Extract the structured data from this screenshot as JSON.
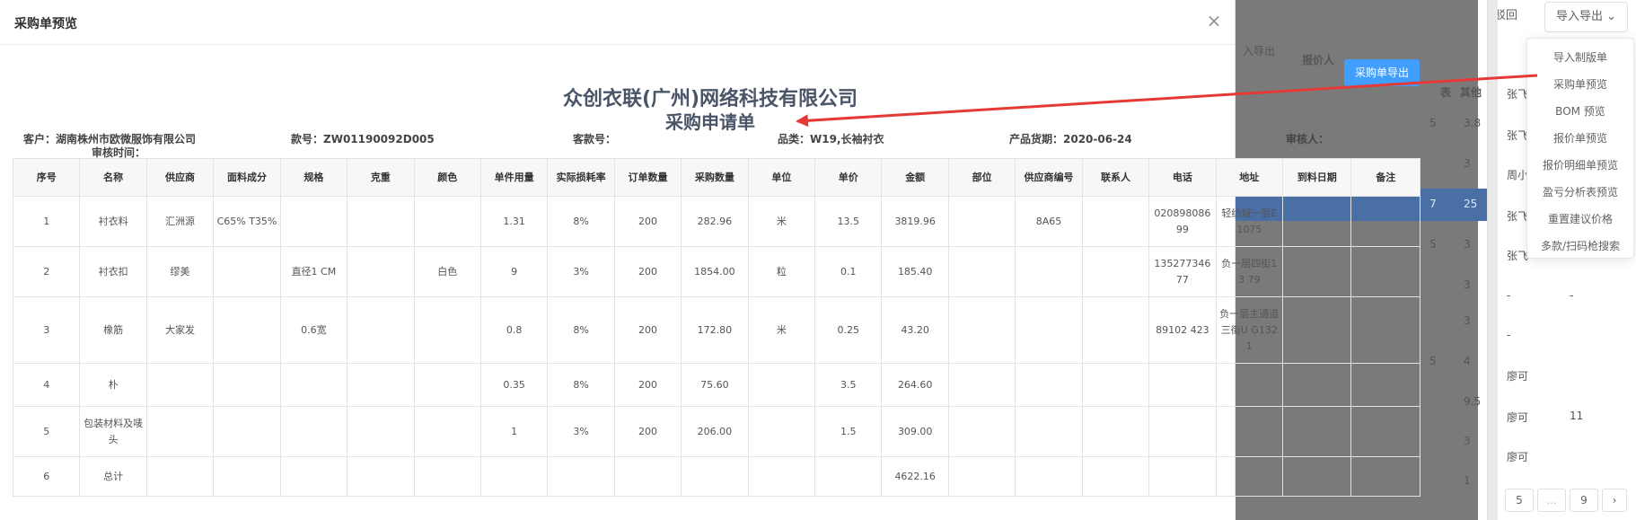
{
  "background": {
    "buttons": {
      "reject": "驳回",
      "import_export": "导入导出"
    },
    "faded_header": [
      "入导出",
      "报价人"
    ],
    "faded_cols": [
      "表",
      "其他"
    ],
    "col_values": [
      {
        "a": "5",
        "b": "3.8"
      },
      {
        "a": "",
        "b": "3"
      },
      {
        "a": "7",
        "b": "25"
      },
      {
        "a": "5",
        "b": "3"
      },
      {
        "a": "",
        "b": "3"
      },
      {
        "a": "",
        "b": "3"
      },
      {
        "a": "5",
        "b": "4"
      },
      {
        "a": "",
        "b": "9.5"
      },
      {
        "a": "",
        "b": "3"
      },
      {
        "a": "",
        "b": "1"
      }
    ],
    "names": [
      "张飞",
      "张飞",
      "周小",
      "张飞",
      "张飞",
      "-",
      "-",
      "廖可",
      "廖可",
      "廖可"
    ],
    "name_extra": [
      "",
      "",
      "",
      "",
      "",
      "-",
      "",
      "",
      "11",
      ""
    ],
    "pager": [
      "5",
      "...",
      "9",
      "›"
    ]
  },
  "dropdown": {
    "items": [
      "导入制版单",
      "采购单预览",
      "BOM 预览",
      "报价单预览",
      "报价明细单预览",
      "盈亏分析表预览",
      "重置建议价格",
      "多款/扫码枪搜索"
    ]
  },
  "modal": {
    "title": "采购单预览",
    "close": "×",
    "export_button": "采购单导出",
    "company": "众创衣联(广州)网络科技有限公司",
    "subtitle": "采购申请单",
    "info": {
      "customer": "客户：湖南株州市欧微服饰有限公司",
      "style_no": "款号：ZW01190092D005",
      "customer_style": "客款号：",
      "category": "品类：W19,长袖衬衣",
      "delivery": "产品货期：2020-06-24",
      "auditor": "审核人：",
      "audit_time": "审核时间："
    },
    "table": {
      "headers": [
        "序号",
        "名称",
        "供应商",
        "面料成分",
        "规格",
        "克重",
        "颜色",
        "单件用量",
        "实际损耗率",
        "订单数量",
        "采购数量",
        "单位",
        "单价",
        "金额",
        "部位",
        "供应商编号",
        "联系人",
        "电话",
        "地址",
        "到料日期",
        "备注"
      ],
      "rows": [
        [
          "1",
          "衬衣料",
          "汇洲源",
          "C65% T35%",
          "",
          "",
          "",
          "1.31",
          "8%",
          "200",
          "282.96",
          "米",
          "13.5",
          "3819.96",
          "",
          "8A65",
          "",
          "020898086 99",
          "轻纺城一层E 1075",
          "",
          ""
        ],
        [
          "2",
          "衬衣扣",
          "缪美",
          "",
          "直径1 CM",
          "",
          "白色",
          "9",
          "3%",
          "200",
          "1854.00",
          "粒",
          "0.1",
          "185.40",
          "",
          "",
          "",
          "135277346 77",
          "负一层四街13 79",
          "",
          ""
        ],
        [
          "3",
          "橡筋",
          "大家发",
          "",
          "0.6宽",
          "",
          "",
          "0.8",
          "8%",
          "200",
          "172.80",
          "米",
          "0.25",
          "43.20",
          "",
          "",
          "",
          "89102 423",
          "负一层主通道三街U G1321",
          "",
          ""
        ],
        [
          "4",
          "朴",
          "",
          "",
          "",
          "",
          "",
          "0.35",
          "8%",
          "200",
          "75.60",
          "",
          "3.5",
          "264.60",
          "",
          "",
          "",
          "",
          "",
          "",
          ""
        ],
        [
          "5",
          "包装材料及唛头",
          "",
          "",
          "",
          "",
          "",
          "1",
          "3%",
          "200",
          "206.00",
          "",
          "1.5",
          "309.00",
          "",
          "",
          "",
          "",
          "",
          "",
          ""
        ],
        [
          "6",
          "总计",
          "",
          "",
          "",
          "",
          "",
          "",
          "",
          "",
          "",
          "",
          "",
          "4622.16",
          "",
          "",
          "",
          "",
          "",
          "",
          ""
        ]
      ]
    }
  },
  "colors": {
    "accent": "#409eff",
    "arrow": "#e53935",
    "highlight": "#4a6fa5"
  }
}
